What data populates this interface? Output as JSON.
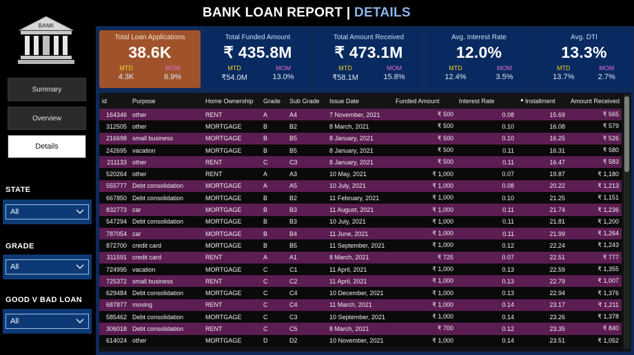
{
  "header": {
    "title_main": "BANK LOAN REPORT",
    "title_sep": "|",
    "title_accent": "DETAILS"
  },
  "logo": {
    "label": "BANK"
  },
  "nav": {
    "summary": "Summary",
    "overview": "Overview",
    "details": "Details"
  },
  "filters": [
    {
      "label": "STATE",
      "value": "All"
    },
    {
      "label": "GRADE",
      "value": "All"
    },
    {
      "label": "GOOD V BAD LOAN",
      "value": "All"
    }
  ],
  "kpis": [
    {
      "title": "Total Loan Applications",
      "value": "38.6K",
      "mtd_label": "MTD",
      "mtd": "4.3K",
      "mom_label": "MOM",
      "mom": "6.9%"
    },
    {
      "title": "Total Funded Amount",
      "value": "₹ 435.8M",
      "mtd_label": "MTD",
      "mtd": "₹54.0M",
      "mom_label": "MOM",
      "mom": "13.0%"
    },
    {
      "title": "Total Amount Received",
      "value": "₹ 473.1M",
      "mtd_label": "MTD",
      "mtd": "₹58.1M",
      "mom_label": "MOM",
      "mom": "15.8%"
    },
    {
      "title": "Avg. Interest Rate",
      "value": "12.0%",
      "mtd_label": "MTD",
      "mtd": "12.4%",
      "mom_label": "MOM",
      "mom": "3.5%"
    },
    {
      "title": "Avg. DTI",
      "value": "13.3%",
      "mtd_label": "MTD",
      "mtd": "13.7%",
      "mom_label": "MOM",
      "mom": "2.7%"
    }
  ],
  "table": {
    "columns": [
      "id",
      "Purpose",
      "Home Ownership",
      "Grade",
      "Sub Grade",
      "Issue Date",
      "Funded Amount",
      "Interest Rate",
      "Installment",
      "Amount Received"
    ],
    "sorted_column_index": 8,
    "rows": [
      [
        "164346",
        "other",
        "RENT",
        "A",
        "A4",
        "7 November, 2021",
        "₹ 500",
        "0.08",
        "15.69",
        "₹ 565"
      ],
      [
        "312505",
        "other",
        "MORTGAGE",
        "B",
        "B2",
        "8 March, 2021",
        "₹ 500",
        "0.10",
        "16.08",
        "₹ 579"
      ],
      [
        "216698",
        "small business",
        "MORTGAGE",
        "B",
        "B5",
        "8 January, 2021",
        "₹ 500",
        "0.10",
        "16.25",
        "₹ 526"
      ],
      [
        "242695",
        "vacation",
        "MORTGAGE",
        "B",
        "B5",
        "8 January, 2021",
        "₹ 500",
        "0.11",
        "16.31",
        "₹ 580"
      ],
      [
        "211133",
        "other",
        "RENT",
        "C",
        "C3",
        "8 January, 2021",
        "₹ 500",
        "0.11",
        "16.47",
        "₹ 583"
      ],
      [
        "520264",
        "other",
        "RENT",
        "A",
        "A3",
        "10 May, 2021",
        "₹ 1,000",
        "0.07",
        "19.87",
        "₹ 1,180"
      ],
      [
        "555777",
        "Debt consolidation",
        "MORTGAGE",
        "A",
        "A5",
        "10 July, 2021",
        "₹ 1,000",
        "0.08",
        "20.22",
        "₹ 1,213"
      ],
      [
        "667850",
        "Debt consolidation",
        "MORTGAGE",
        "B",
        "B2",
        "11 February, 2021",
        "₹ 1,000",
        "0.10",
        "21.25",
        "₹ 1,151"
      ],
      [
        "832773",
        "car",
        "MORTGAGE",
        "B",
        "B3",
        "11 August, 2021",
        "₹ 1,000",
        "0.11",
        "21.74",
        "₹ 1,236"
      ],
      [
        "547294",
        "Debt consolidation",
        "MORTGAGE",
        "B",
        "B3",
        "10 July, 2021",
        "₹ 1,000",
        "0.11",
        "21.81",
        "₹ 1,200"
      ],
      [
        "787054",
        "car",
        "MORTGAGE",
        "B",
        "B4",
        "11 June, 2021",
        "₹ 1,000",
        "0.11",
        "21.99",
        "₹ 1,264"
      ],
      [
        "872700",
        "credit card",
        "MORTGAGE",
        "B",
        "B5",
        "11 September, 2021",
        "₹ 1,000",
        "0.12",
        "22.24",
        "₹ 1,243"
      ],
      [
        "311591",
        "credit card",
        "RENT",
        "A",
        "A1",
        "8 March, 2021",
        "₹ 725",
        "0.07",
        "22.51",
        "₹ 777"
      ],
      [
        "724995",
        "vacation",
        "MORTGAGE",
        "C",
        "C1",
        "11 April, 2021",
        "₹ 1,000",
        "0.13",
        "22.59",
        "₹ 1,355"
      ],
      [
        "725372",
        "small business",
        "RENT",
        "C",
        "C2",
        "11 April, 2021",
        "₹ 1,000",
        "0.13",
        "22.79",
        "₹ 1,007"
      ],
      [
        "629484",
        "Debt consolidation",
        "MORTGAGE",
        "C",
        "C4",
        "10 December, 2021",
        "₹ 1,000",
        "0.13",
        "22.94",
        "₹ 1,376"
      ],
      [
        "687877",
        "moving",
        "RENT",
        "C",
        "C4",
        "11 March, 2021",
        "₹ 1,000",
        "0.14",
        "23.17",
        "₹ 1,211"
      ],
      [
        "585462",
        "Debt consolidation",
        "MORTGAGE",
        "C",
        "C3",
        "10 September, 2021",
        "₹ 1,000",
        "0.14",
        "23.26",
        "₹ 1,378"
      ],
      [
        "306018",
        "Debt consolidation",
        "RENT",
        "C",
        "C5",
        "8 March, 2021",
        "₹ 700",
        "0.12",
        "23.35",
        "₹ 840"
      ],
      [
        "614024",
        "other",
        "MORTGAGE",
        "D",
        "D2",
        "10 November, 2021",
        "₹ 1,000",
        "0.14",
        "23.51",
        "₹ 1,052"
      ]
    ]
  },
  "colors": {
    "panel_blue": "#0d2a5a",
    "kpi_blue": "#082a60",
    "kpi_highlight": "#a0532b",
    "row_purple": "#5c1d52",
    "accent_text": "#8ab6ea",
    "mtd_yellow": "#f2d22b",
    "mom_pink": "#e06fd8"
  }
}
